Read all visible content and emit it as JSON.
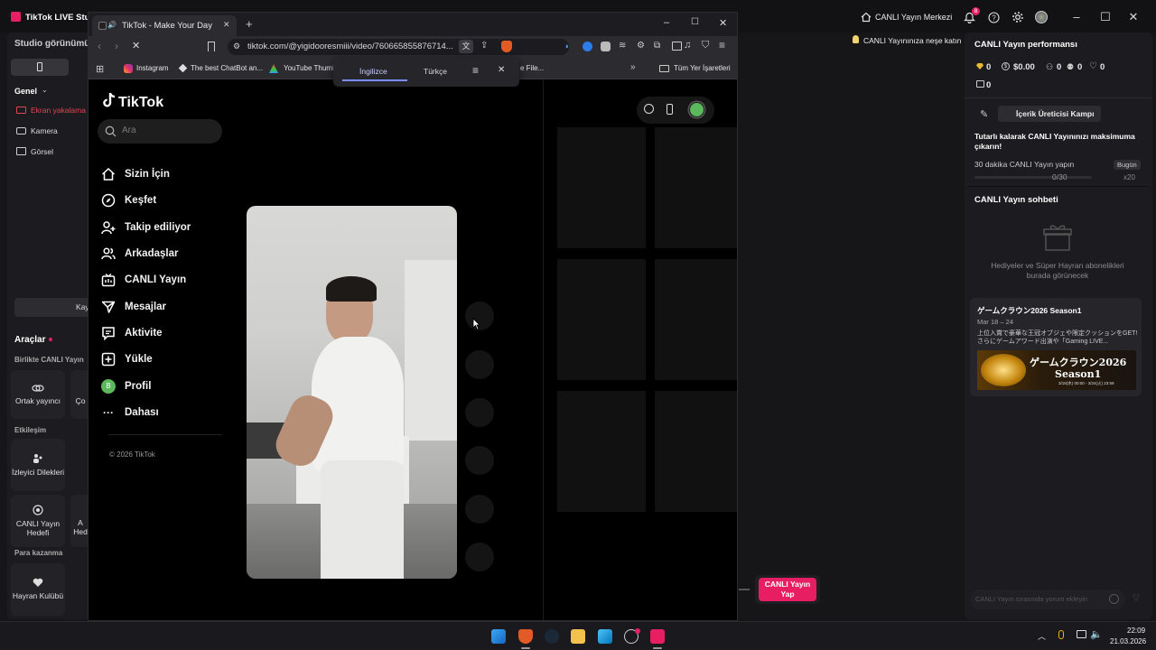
{
  "studio": {
    "app_title": "TikTok LIVE Stud",
    "header_live_center": "CANLI Yayın Merkezi",
    "notification_count": "8",
    "banner": "CANLI Yayınınıza neşe katın",
    "left": {
      "view_title": "Studio görünümü",
      "general": "Genel",
      "sources": [
        "Ekran yakalama",
        "Kamera",
        "Görsel"
      ],
      "kay_button": "Kay",
      "tools_title": "Araçlar",
      "together_live": "Birlikte CANLI Yayın",
      "tools_row1": [
        "Ortak yayıncı",
        "Ço"
      ],
      "engagement": "Etkileşim",
      "tools_row2": [
        "İzleyici Dilekleri"
      ],
      "tools_row3": [
        "CANLI Yayın Hedefi",
        "A Hed"
      ],
      "earn": "Para kazanma",
      "tools_row4": [
        "Hayran Kulübü"
      ]
    },
    "right": {
      "perf_title": "CANLI Yayın performansı",
      "stats": [
        "0",
        "$0.00",
        "0",
        "0",
        "0",
        "0"
      ],
      "camp_button": "İçerik Üreticisi Kampı",
      "promo_title": "Tutarlı kalarak CANLI Yayınınızı maksimuma çıkarın!",
      "task_text": "30 dakika CANLI Yayın yapın",
      "task_badge": "Bugün",
      "task_progress_text": "0/30",
      "task_reward": "x20",
      "chat_title": "CANLI Yayın sohbeti",
      "chat_empty": "Hediyeler ve Süper Hayran abonelikleri burada görünecek",
      "event_title": "ゲームクラウン2026 Season1",
      "event_dates": "Mar 18 – 24",
      "event_desc": "上位入賞で豪華な王冠オブジェや限定クッションをGET! さらにゲームアワード出演や「Gaming LIVE...",
      "event_banner_line1": "ゲームクラウン2026",
      "event_banner_line2": "Season1",
      "event_banner_small": "3/18(水) 00:00 - 3/24(火) 23:59",
      "chat_placeholder": "CANLI Yayın sırasında yorum ekleyin"
    },
    "go_live_button": "CANLI Yayın Yap"
  },
  "browser": {
    "tab_title": "TikTok - Make Your Day",
    "url": "tiktok.com/@yigidooresmiii/video/760665855876714...",
    "bookmarks": [
      "Instagram",
      "The best ChatBot an...",
      "YouTube Thumi",
      "e File..."
    ],
    "bookmarks_folder": "Tüm Yer İşaretleri",
    "translate": {
      "tab_active": "İngilizce",
      "tab_inactive": "Türkçe"
    },
    "page": {
      "logo": "TikTok",
      "search_placeholder": "Ara",
      "nav": [
        "Sizin İçin",
        "Keşfet",
        "Takip ediliyor",
        "Arkadaşlar",
        "CANLI Yayın",
        "Mesajlar",
        "Aktivite",
        "Yükle",
        "Profil",
        "Dahası"
      ],
      "profile_initial": "B",
      "copyright": "© 2026 TikTok"
    }
  },
  "taskbar": {
    "time": "22:09",
    "date": "21.03.2026"
  },
  "colors": {
    "accent_pink": "#e81e63",
    "tiktok_green": "#5cb85c",
    "translate_underline": "#7b8cff"
  }
}
